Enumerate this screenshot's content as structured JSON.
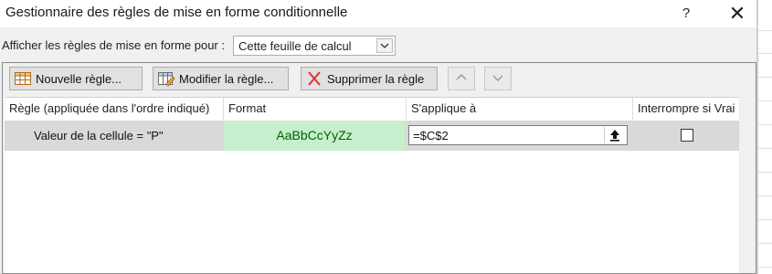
{
  "window": {
    "title": "Gestionnaire des règles de mise en forme conditionnelle",
    "help_label": "?",
    "close_label": "✕"
  },
  "show_rules": {
    "label": "Afficher les règles de mise en forme pour :",
    "selected": "Cette feuille de calcul"
  },
  "toolbar": {
    "new_label": "Nouvelle règle...",
    "edit_label": "Modifier la règle...",
    "delete_label": "Supprimer la règle",
    "new_icon": "table-icon",
    "edit_icon": "edit-table-icon",
    "delete_icon": "red-x-icon",
    "up_icon": "chevron-up-icon",
    "down_icon": "chevron-down-icon"
  },
  "grid": {
    "headers": {
      "rule": "Règle (appliquée dans l'ordre indiqué)",
      "format": "Format",
      "applies": "S'applique à",
      "stop": "Interrompre si Vrai"
    },
    "rows": [
      {
        "rule": "Valeur de la cellule = \"P\"",
        "format_preview": "AaBbCcYyZz",
        "applies_to": "=$C$2",
        "stop_if_true": false
      }
    ]
  },
  "colors": {
    "format_fill": "#c6efce",
    "format_text": "#006100",
    "selected_row": "#d9d9d9",
    "delete_icon": "#e03030"
  }
}
